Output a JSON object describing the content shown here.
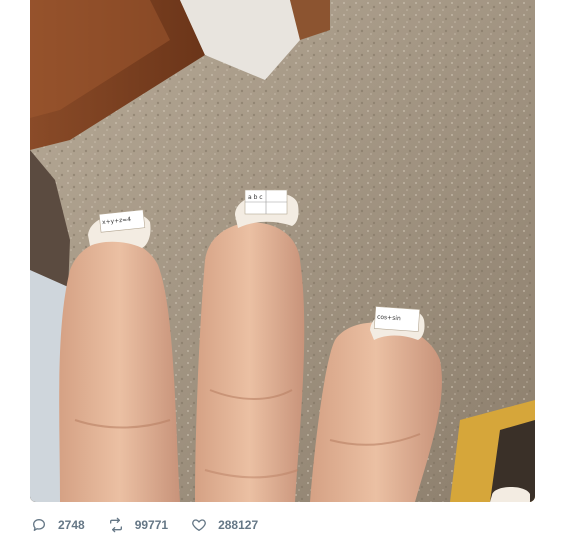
{
  "tweet": {
    "media": {
      "image_alt": "",
      "nail_text_left": "x+y+z=4",
      "nail_text_middle": "a b c",
      "nail_text_right": "cos+sin"
    },
    "actions": {
      "reply": {
        "icon": "reply-icon",
        "count": "2748"
      },
      "retweet": {
        "icon": "retweet-icon",
        "count": "99771"
      },
      "like": {
        "icon": "heart-icon",
        "count": "288127"
      }
    },
    "colors": {
      "action_gray": "#657786"
    }
  }
}
